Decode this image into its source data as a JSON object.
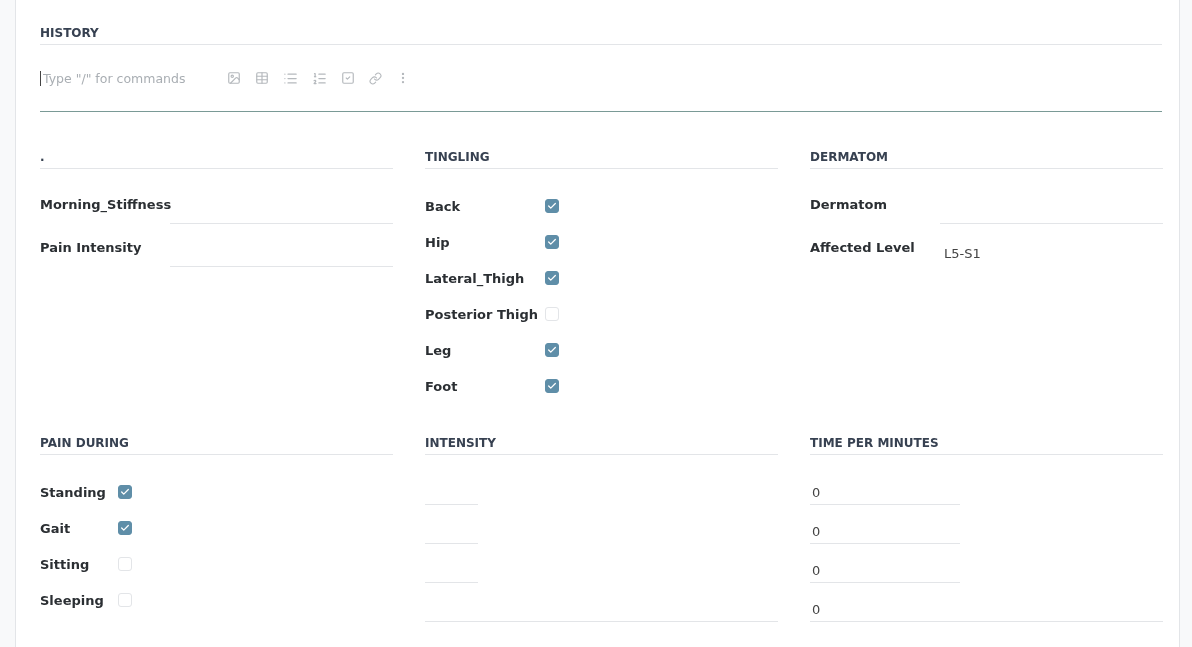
{
  "history": {
    "title": "HISTORY",
    "placeholder": "Type \"/\" for commands"
  },
  "top_sections": [
    {
      "kind": "fields",
      "title": ".",
      "fields": [
        {
          "label": "Morning_Stiffness"
        },
        {
          "label": "Pain Intensity"
        }
      ]
    },
    {
      "kind": "checks",
      "title": "TINGLING",
      "items": [
        {
          "label": "Back",
          "checked": true
        },
        {
          "label": "Hip",
          "checked": true
        },
        {
          "label": "Lateral_Thigh",
          "checked": true
        },
        {
          "label": "Posterior Thigh",
          "checked": false
        },
        {
          "label": "Leg",
          "checked": true
        },
        {
          "label": "Foot",
          "checked": true
        }
      ]
    },
    {
      "kind": "fields",
      "title": "DERMATOM",
      "fields": [
        {
          "label": "Dermatom"
        },
        {
          "label": "Affected Level",
          "value": "L5-S1"
        }
      ]
    }
  ],
  "bottom_sections": [
    {
      "kind": "checks",
      "title": "PAIN DURING",
      "items": [
        {
          "label": "Standing",
          "checked": true
        },
        {
          "label": "Gait",
          "checked": true
        },
        {
          "label": "Sitting",
          "checked": false
        },
        {
          "label": "Sleeping",
          "checked": false
        }
      ]
    },
    {
      "kind": "inputs",
      "title": "INTENSITY",
      "inputs": [
        {
          "kind": "short"
        },
        {
          "kind": "short"
        },
        {
          "kind": "short"
        },
        {
          "kind": "wide"
        }
      ]
    },
    {
      "kind": "inputs",
      "title": "TIME PER MINUTES",
      "inputs": [
        {
          "kind": "medium",
          "value": "0"
        },
        {
          "kind": "medium",
          "value": "0"
        },
        {
          "kind": "medium",
          "value": "0"
        },
        {
          "kind": "wide",
          "value": "0"
        }
      ]
    }
  ]
}
